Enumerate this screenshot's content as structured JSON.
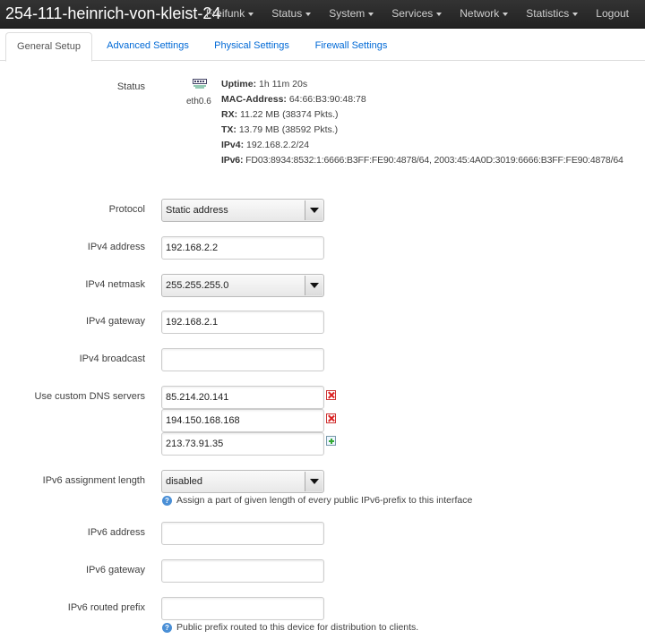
{
  "brand": "254-111-heinrich-von-kleist-24",
  "nav": [
    "Freifunk",
    "Status",
    "System",
    "Services",
    "Network",
    "Statistics",
    "Logout"
  ],
  "tabs": [
    "General Setup",
    "Advanced Settings",
    "Physical Settings",
    "Firewall Settings"
  ],
  "status": {
    "label": "Status",
    "iface": "eth0.6",
    "uptime_label": "Uptime:",
    "uptime": "1h 11m 20s",
    "mac_label": "MAC-Address:",
    "mac": "64:66:B3:90:48:78",
    "rx_label": "RX:",
    "rx": "11.22 MB (38374 Pkts.)",
    "tx_label": "TX:",
    "tx": "13.79 MB (38592 Pkts.)",
    "ipv4_label": "IPv4:",
    "ipv4": "192.168.2.2/24",
    "ipv6_label": "IPv6:",
    "ipv6": "FD03:8934:8532:1:6666:B3FF:FE90:4878/64, 2003:45:4A0D:3019:6666:B3FF:FE90:4878/64"
  },
  "form": {
    "protocol": {
      "label": "Protocol",
      "value": "Static address"
    },
    "ipv4_address": {
      "label": "IPv4 address",
      "value": "192.168.2.2"
    },
    "ipv4_netmask": {
      "label": "IPv4 netmask",
      "value": "255.255.255.0"
    },
    "ipv4_gateway": {
      "label": "IPv4 gateway",
      "value": "192.168.2.1"
    },
    "ipv4_broadcast": {
      "label": "IPv4 broadcast",
      "value": ""
    },
    "dns": {
      "label": "Use custom DNS servers",
      "values": [
        "85.214.20.141",
        "194.150.168.168",
        "213.73.91.35"
      ]
    },
    "ipv6_assign": {
      "label": "IPv6 assignment length",
      "value": "disabled",
      "help": "Assign a part of given length of every public IPv6-prefix to this interface"
    },
    "ipv6_address": {
      "label": "IPv6 address",
      "value": ""
    },
    "ipv6_gateway": {
      "label": "IPv6 gateway",
      "value": ""
    },
    "ipv6_prefix": {
      "label": "IPv6 routed prefix",
      "value": "",
      "help": "Public prefix routed to this device for distribution to clients."
    }
  }
}
